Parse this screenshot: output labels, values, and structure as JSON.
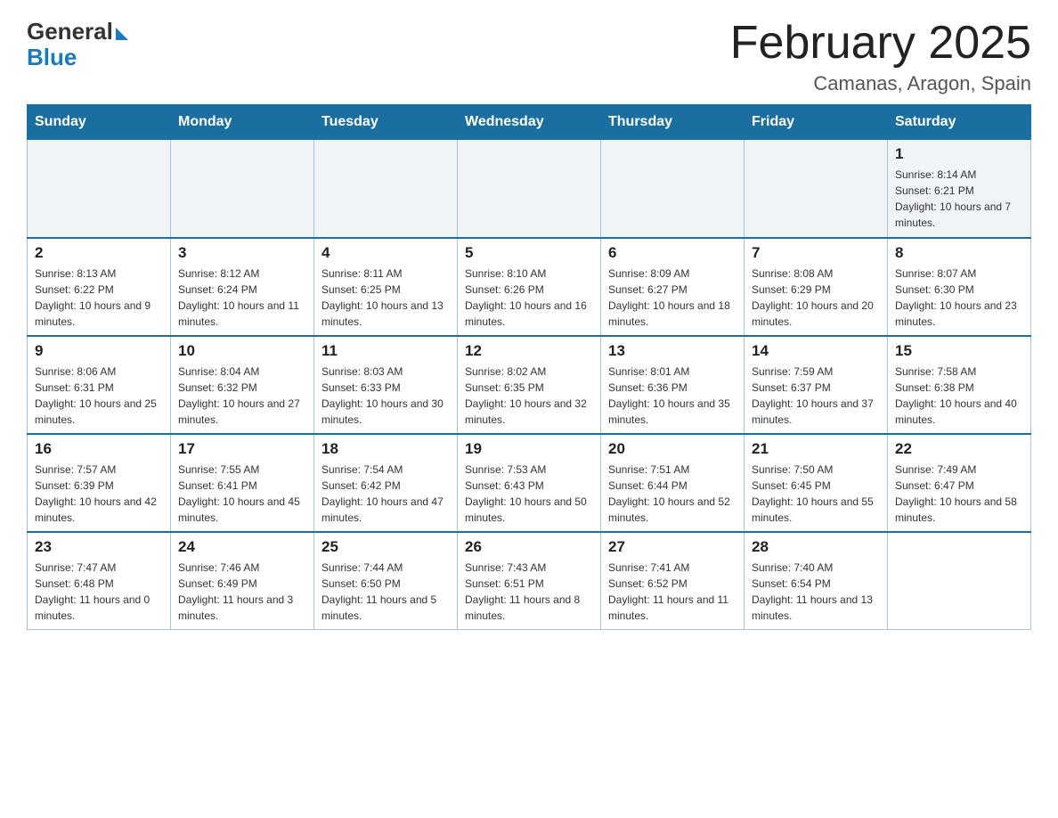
{
  "header": {
    "logo": {
      "general": "General",
      "blue": "Blue"
    },
    "title": "February 2025",
    "subtitle": "Camanas, Aragon, Spain"
  },
  "weekdays": [
    "Sunday",
    "Monday",
    "Tuesday",
    "Wednesday",
    "Thursday",
    "Friday",
    "Saturday"
  ],
  "weeks": [
    [
      {
        "day": "",
        "info": ""
      },
      {
        "day": "",
        "info": ""
      },
      {
        "day": "",
        "info": ""
      },
      {
        "day": "",
        "info": ""
      },
      {
        "day": "",
        "info": ""
      },
      {
        "day": "",
        "info": ""
      },
      {
        "day": "1",
        "info": "Sunrise: 8:14 AM\nSunset: 6:21 PM\nDaylight: 10 hours and 7 minutes."
      }
    ],
    [
      {
        "day": "2",
        "info": "Sunrise: 8:13 AM\nSunset: 6:22 PM\nDaylight: 10 hours and 9 minutes."
      },
      {
        "day": "3",
        "info": "Sunrise: 8:12 AM\nSunset: 6:24 PM\nDaylight: 10 hours and 11 minutes."
      },
      {
        "day": "4",
        "info": "Sunrise: 8:11 AM\nSunset: 6:25 PM\nDaylight: 10 hours and 13 minutes."
      },
      {
        "day": "5",
        "info": "Sunrise: 8:10 AM\nSunset: 6:26 PM\nDaylight: 10 hours and 16 minutes."
      },
      {
        "day": "6",
        "info": "Sunrise: 8:09 AM\nSunset: 6:27 PM\nDaylight: 10 hours and 18 minutes."
      },
      {
        "day": "7",
        "info": "Sunrise: 8:08 AM\nSunset: 6:29 PM\nDaylight: 10 hours and 20 minutes."
      },
      {
        "day": "8",
        "info": "Sunrise: 8:07 AM\nSunset: 6:30 PM\nDaylight: 10 hours and 23 minutes."
      }
    ],
    [
      {
        "day": "9",
        "info": "Sunrise: 8:06 AM\nSunset: 6:31 PM\nDaylight: 10 hours and 25 minutes."
      },
      {
        "day": "10",
        "info": "Sunrise: 8:04 AM\nSunset: 6:32 PM\nDaylight: 10 hours and 27 minutes."
      },
      {
        "day": "11",
        "info": "Sunrise: 8:03 AM\nSunset: 6:33 PM\nDaylight: 10 hours and 30 minutes."
      },
      {
        "day": "12",
        "info": "Sunrise: 8:02 AM\nSunset: 6:35 PM\nDaylight: 10 hours and 32 minutes."
      },
      {
        "day": "13",
        "info": "Sunrise: 8:01 AM\nSunset: 6:36 PM\nDaylight: 10 hours and 35 minutes."
      },
      {
        "day": "14",
        "info": "Sunrise: 7:59 AM\nSunset: 6:37 PM\nDaylight: 10 hours and 37 minutes."
      },
      {
        "day": "15",
        "info": "Sunrise: 7:58 AM\nSunset: 6:38 PM\nDaylight: 10 hours and 40 minutes."
      }
    ],
    [
      {
        "day": "16",
        "info": "Sunrise: 7:57 AM\nSunset: 6:39 PM\nDaylight: 10 hours and 42 minutes."
      },
      {
        "day": "17",
        "info": "Sunrise: 7:55 AM\nSunset: 6:41 PM\nDaylight: 10 hours and 45 minutes."
      },
      {
        "day": "18",
        "info": "Sunrise: 7:54 AM\nSunset: 6:42 PM\nDaylight: 10 hours and 47 minutes."
      },
      {
        "day": "19",
        "info": "Sunrise: 7:53 AM\nSunset: 6:43 PM\nDaylight: 10 hours and 50 minutes."
      },
      {
        "day": "20",
        "info": "Sunrise: 7:51 AM\nSunset: 6:44 PM\nDaylight: 10 hours and 52 minutes."
      },
      {
        "day": "21",
        "info": "Sunrise: 7:50 AM\nSunset: 6:45 PM\nDaylight: 10 hours and 55 minutes."
      },
      {
        "day": "22",
        "info": "Sunrise: 7:49 AM\nSunset: 6:47 PM\nDaylight: 10 hours and 58 minutes."
      }
    ],
    [
      {
        "day": "23",
        "info": "Sunrise: 7:47 AM\nSunset: 6:48 PM\nDaylight: 11 hours and 0 minutes."
      },
      {
        "day": "24",
        "info": "Sunrise: 7:46 AM\nSunset: 6:49 PM\nDaylight: 11 hours and 3 minutes."
      },
      {
        "day": "25",
        "info": "Sunrise: 7:44 AM\nSunset: 6:50 PM\nDaylight: 11 hours and 5 minutes."
      },
      {
        "day": "26",
        "info": "Sunrise: 7:43 AM\nSunset: 6:51 PM\nDaylight: 11 hours and 8 minutes."
      },
      {
        "day": "27",
        "info": "Sunrise: 7:41 AM\nSunset: 6:52 PM\nDaylight: 11 hours and 11 minutes."
      },
      {
        "day": "28",
        "info": "Sunrise: 7:40 AM\nSunset: 6:54 PM\nDaylight: 11 hours and 13 minutes."
      },
      {
        "day": "",
        "info": ""
      }
    ]
  ]
}
